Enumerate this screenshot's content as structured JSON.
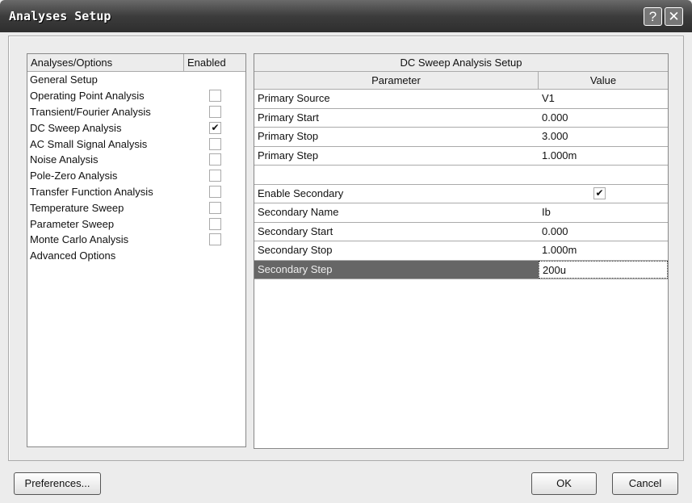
{
  "window": {
    "title": "Analyses Setup",
    "help": "?",
    "close": "✕"
  },
  "left": {
    "col1": "Analyses/Options",
    "col2": "Enabled",
    "items": [
      {
        "label": "General Setup",
        "checkbox": false
      },
      {
        "label": "Operating Point Analysis",
        "checkbox": true,
        "checked": false
      },
      {
        "label": "Transient/Fourier Analysis",
        "checkbox": true,
        "checked": false
      },
      {
        "label": "DC Sweep Analysis",
        "checkbox": true,
        "checked": true
      },
      {
        "label": "AC Small Signal Analysis",
        "checkbox": true,
        "checked": false
      },
      {
        "label": "Noise Analysis",
        "checkbox": true,
        "checked": false
      },
      {
        "label": "Pole-Zero Analysis",
        "checkbox": true,
        "checked": false
      },
      {
        "label": "Transfer Function Analysis",
        "checkbox": true,
        "checked": false
      },
      {
        "label": "Temperature Sweep",
        "checkbox": true,
        "checked": false
      },
      {
        "label": "Parameter Sweep",
        "checkbox": true,
        "checked": false
      },
      {
        "label": "Monte Carlo Analysis",
        "checkbox": true,
        "checked": false
      },
      {
        "label": "Advanced Options",
        "checkbox": false
      }
    ]
  },
  "right": {
    "title": "DC Sweep Analysis Setup",
    "col1": "Parameter",
    "col2": "Value",
    "rows": [
      {
        "p": "Primary Source",
        "v": "V1"
      },
      {
        "p": "Primary Start",
        "v": "0.000"
      },
      {
        "p": "Primary Stop",
        "v": "3.000"
      },
      {
        "p": "Primary Step",
        "v": "1.000m"
      },
      {
        "p": "",
        "v": ""
      },
      {
        "p": "Enable Secondary",
        "v": "",
        "check": true
      },
      {
        "p": "Secondary Name",
        "v": "Ib"
      },
      {
        "p": "Secondary Start",
        "v": "0.000"
      },
      {
        "p": "Secondary Stop",
        "v": "1.000m"
      },
      {
        "p": "Secondary Step",
        "v": "200u",
        "selected": true
      }
    ]
  },
  "buttons": {
    "preferences": "Preferences...",
    "ok": "OK",
    "cancel": "Cancel"
  }
}
